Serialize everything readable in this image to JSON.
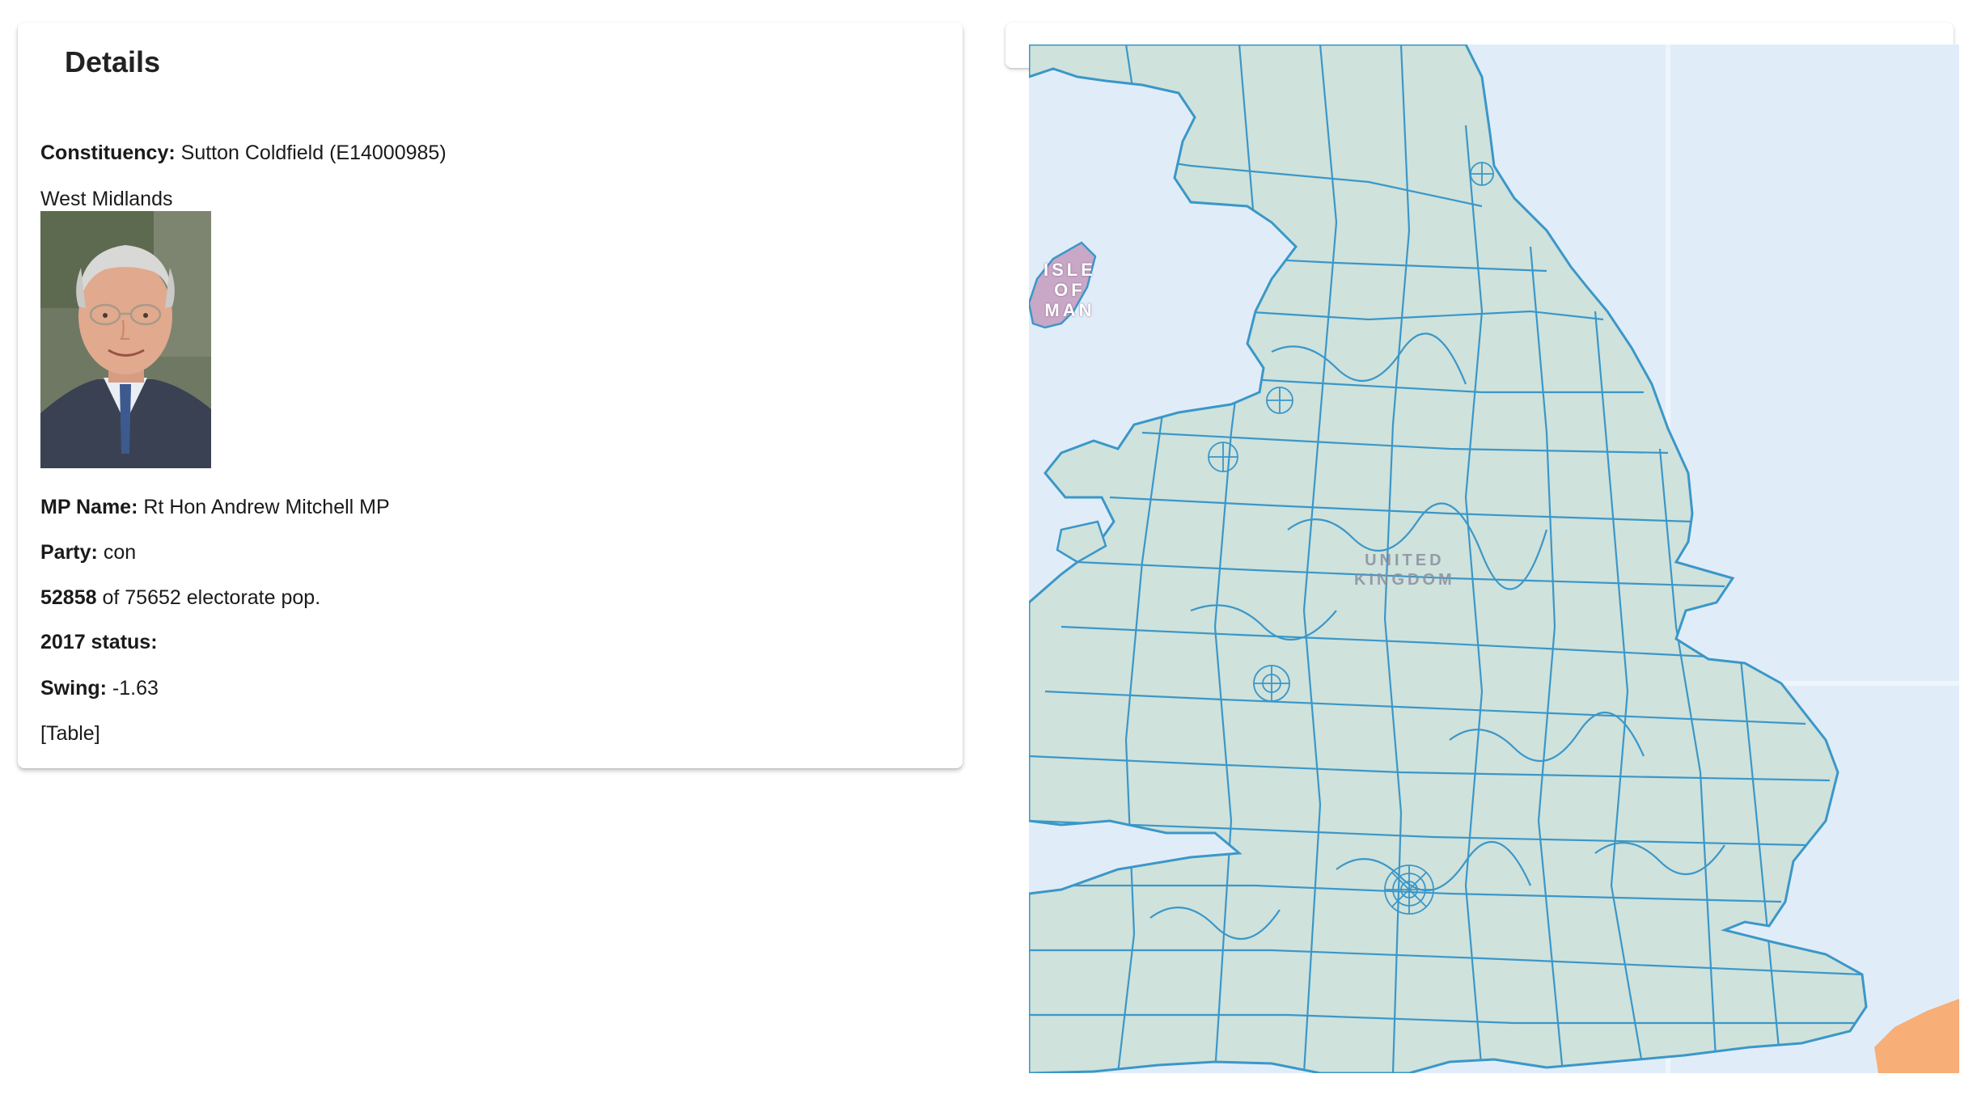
{
  "details": {
    "title": "Details",
    "constituency_label": "Constituency:",
    "constituency_value": "Sutton Coldfield (E14000985)",
    "region": "West Midlands",
    "photo_alt": "MP portrait",
    "mp_label": "MP Name:",
    "mp_value": "Rt Hon Andrew Mitchell MP",
    "party_label": "Party:",
    "party_value": "con",
    "turnout_value": "52858",
    "turnout_suffix": "of 75652 electorate pop.",
    "status_label": "2017 status:",
    "status_value": "",
    "swing_label": "Swing:",
    "swing_value": "-1.63",
    "table_link": "[Table]"
  },
  "map": {
    "iom_label_line1": "ISLE",
    "iom_label_line2": "OF",
    "iom_label_line3": "MAN",
    "country_label_line1": "UNITED",
    "country_label_line2": "KINGDOM",
    "colors": {
      "sea": "#dcebf8",
      "land": "#cfe2dc",
      "boundary": "#3b97c8",
      "isle_of_man": "#c9a7c7",
      "france": "#f7ae77"
    }
  }
}
